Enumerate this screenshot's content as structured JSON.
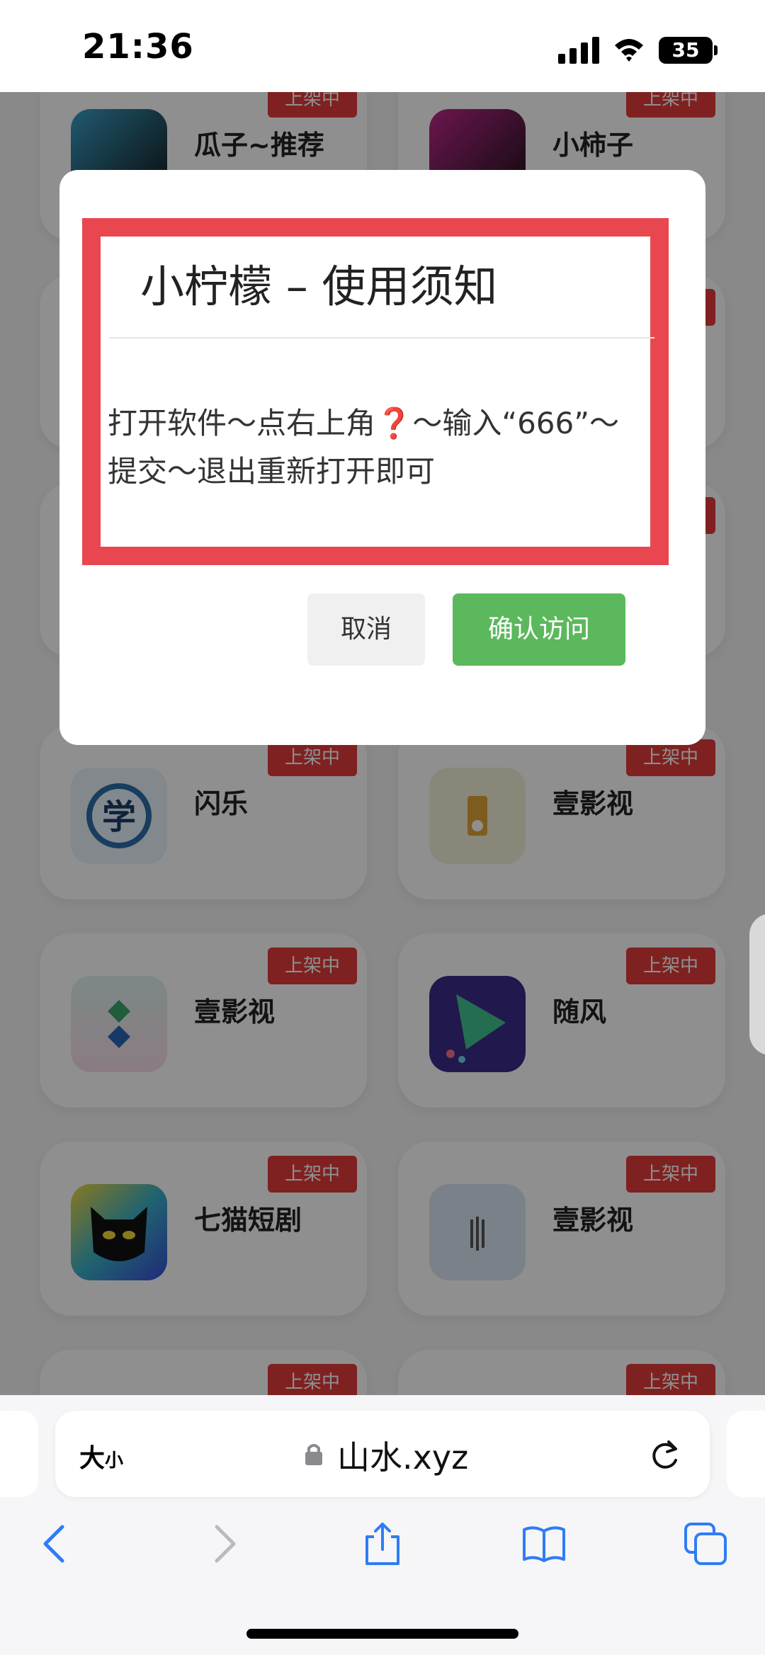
{
  "status_bar": {
    "time": "21:36",
    "battery": "35"
  },
  "apps": [
    {
      "name": "瓜子~推荐",
      "badge": "上架中"
    },
    {
      "name": "小柿子",
      "badge": "上架中"
    },
    {
      "name": "闪乐",
      "badge": "上架中"
    },
    {
      "name": "壹影视",
      "badge": "上架中"
    },
    {
      "name": "壹影视",
      "badge": "上架中"
    },
    {
      "name": "随风",
      "badge": "上架中"
    },
    {
      "name": "七猫短剧",
      "badge": "上架中"
    },
    {
      "name": "壹影视",
      "badge": "上架中"
    },
    {
      "name": "",
      "badge": "上架中"
    },
    {
      "name": "",
      "badge": "上架中"
    }
  ],
  "dialog": {
    "title": "小柠檬 – 使用须知",
    "body_before": "打开软件～点右上角",
    "body_mark": "❓",
    "body_after": "～输入“666”～提交～退出重新打开即可",
    "cancel_label": "取消",
    "confirm_label": "确认访问"
  },
  "safari": {
    "text_size_label_big": "大",
    "text_size_label_small": "小",
    "url": "山水.xyz"
  },
  "colors": {
    "badge": "#e23b3b",
    "frame": "#e8474f",
    "confirm": "#5cb85c",
    "link_blue": "#2f7cf6"
  }
}
